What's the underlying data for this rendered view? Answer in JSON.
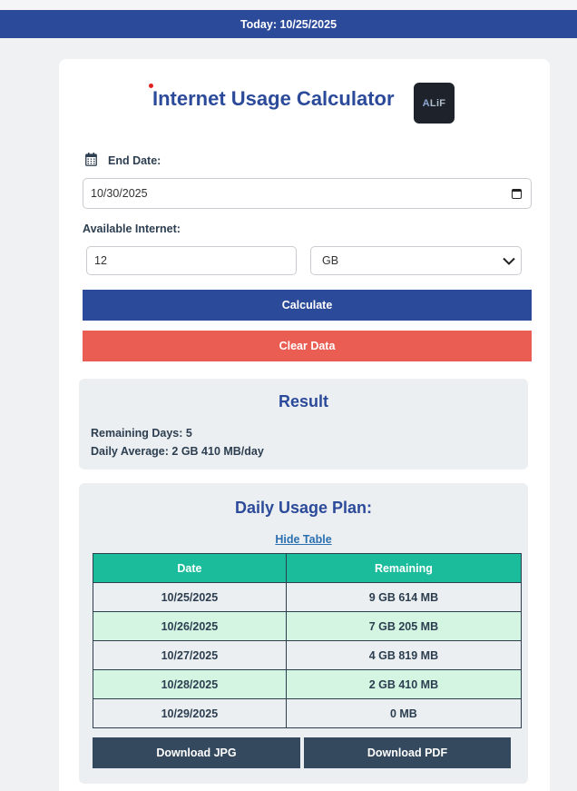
{
  "banner": {
    "today_text": "Today: 10/25/2025"
  },
  "header": {
    "title": "Internet Usage Calculator",
    "logo_text_a": "A",
    "logo_text_rest": "LiF"
  },
  "form": {
    "end_date_label": "End Date:",
    "end_date_value": "10/30/2025",
    "available_label": "Available Internet:",
    "amount_value": "12",
    "unit_value": "GB",
    "calculate_label": "Calculate",
    "clear_label": "Clear Data"
  },
  "result": {
    "title": "Result",
    "remaining_days": "Remaining Days: 5",
    "daily_average": "Daily Average: 2 GB 410 MB/day"
  },
  "plan": {
    "title": "Daily Usage Plan:",
    "hide_link": "Hide Table",
    "columns": [
      "Date",
      "Remaining"
    ],
    "rows": [
      {
        "date": "10/25/2025",
        "remaining": "9 GB 614 MB"
      },
      {
        "date": "10/26/2025",
        "remaining": "7 GB 205 MB"
      },
      {
        "date": "10/27/2025",
        "remaining": "4 GB 819 MB"
      },
      {
        "date": "10/28/2025",
        "remaining": "2 GB 410 MB"
      },
      {
        "date": "10/29/2025",
        "remaining": "0 MB"
      }
    ],
    "download_jpg": "Download JPG",
    "download_pdf": "Download PDF"
  },
  "colors": {
    "primary": "#2c4a9a",
    "danger": "#e95d52",
    "table_header": "#1abc9c",
    "row_alt": "#d5f5e3",
    "dark_button": "#34495e"
  }
}
